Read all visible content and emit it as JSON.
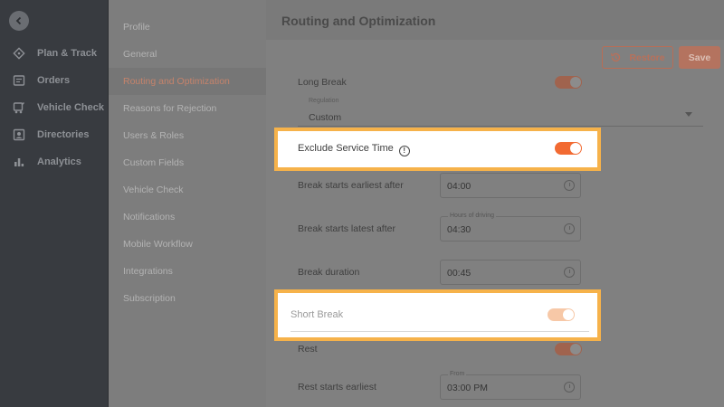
{
  "nav": {
    "items": [
      {
        "label": "Plan & Track",
        "icon": "route-icon"
      },
      {
        "label": "Orders",
        "icon": "orders-icon"
      },
      {
        "label": "Vehicle Check",
        "icon": "vehicle-check-icon"
      },
      {
        "label": "Directories",
        "icon": "directories-icon"
      },
      {
        "label": "Analytics",
        "icon": "analytics-icon"
      }
    ]
  },
  "menu": {
    "items": [
      {
        "label": "Profile"
      },
      {
        "label": "General"
      },
      {
        "label": "Routing and Optimization"
      },
      {
        "label": "Reasons for Rejection"
      },
      {
        "label": "Users & Roles"
      },
      {
        "label": "Custom Fields"
      },
      {
        "label": "Vehicle Check"
      },
      {
        "label": "Notifications"
      },
      {
        "label": "Mobile Workflow"
      },
      {
        "label": "Integrations"
      },
      {
        "label": "Subscription"
      }
    ],
    "active_index": 2
  },
  "header": {
    "title": "Routing and Optimization",
    "restore_label": "Restore",
    "save_label": "Save"
  },
  "form": {
    "long_break_label": "Long Break",
    "regulation_caption": "Regulation",
    "regulation_value": "Custom",
    "exclude_service_time_label": "Exclude Service Time",
    "break_earliest_label": "Break starts earliest after",
    "break_earliest_value": "04:00",
    "break_latest_label": "Break starts latest after",
    "break_latest_caption": "Hours of driving",
    "break_latest_value": "04:30",
    "break_duration_label": "Break duration",
    "break_duration_value": "00:45",
    "short_break_label": "Short Break",
    "rest_label": "Rest",
    "rest_earliest_label": "Rest starts earliest",
    "rest_earliest_caption": "From",
    "rest_earliest_value": "03:00 PM"
  },
  "colors": {
    "accent": "#f26a32",
    "highlight_border": "#f6b24a"
  }
}
